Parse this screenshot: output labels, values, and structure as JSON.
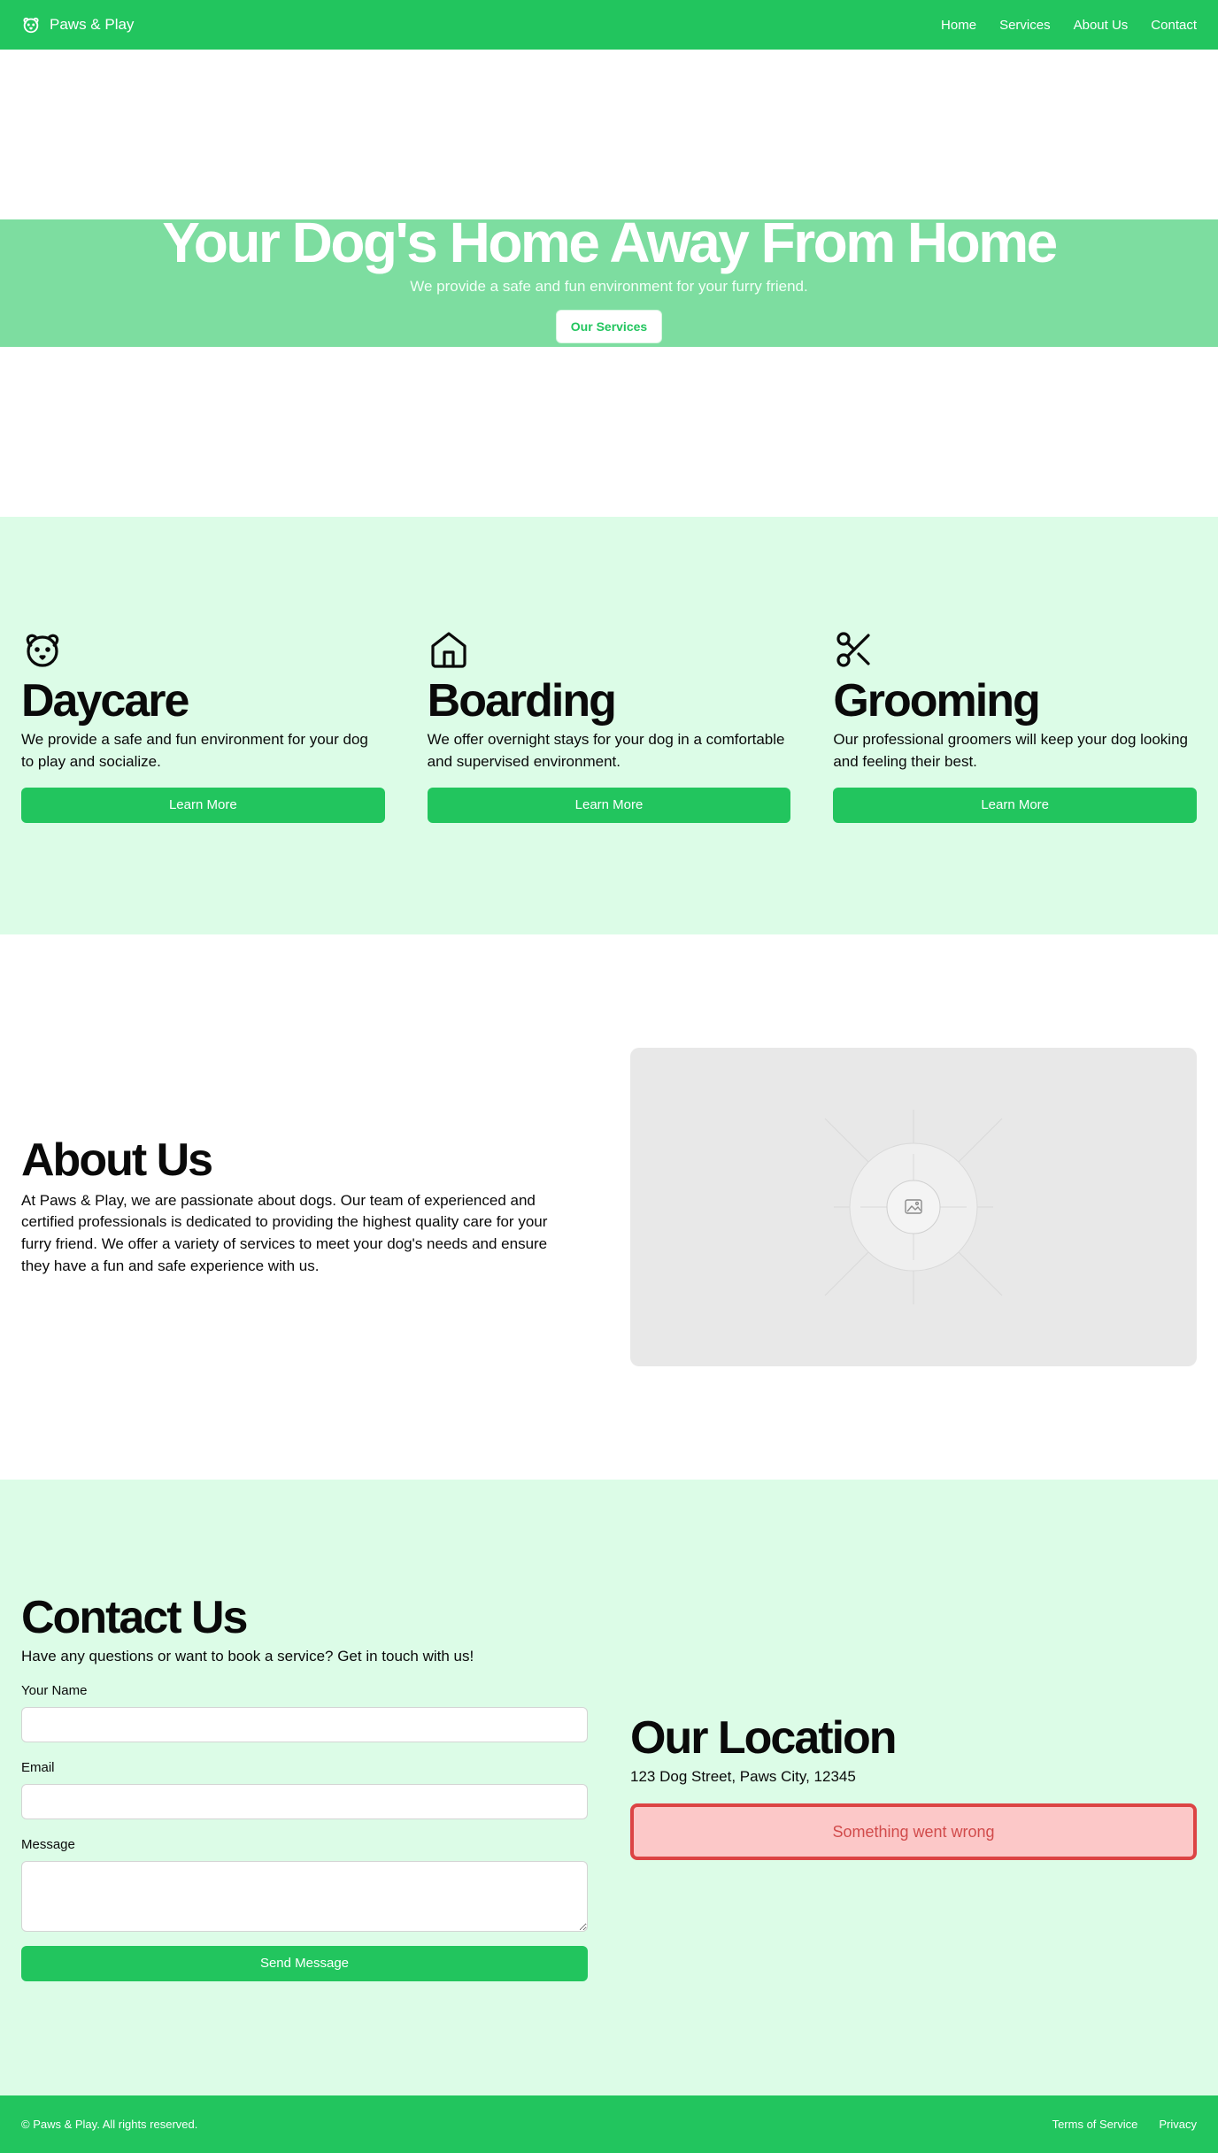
{
  "header": {
    "brand": "Paws & Play",
    "nav": [
      "Home",
      "Services",
      "About Us",
      "Contact"
    ]
  },
  "hero": {
    "title": "Your Dog's Home Away From Home",
    "subtitle": "We provide a safe and fun environment for your furry friend.",
    "cta": "Our Services"
  },
  "services": [
    {
      "icon": "dog-icon",
      "title": "Daycare",
      "description": "We provide a safe and fun environment for your dog to play and socialize.",
      "button": "Learn More"
    },
    {
      "icon": "house-icon",
      "title": "Boarding",
      "description": "We offer overnight stays for your dog in a comfortable and supervised environment.",
      "button": "Learn More"
    },
    {
      "icon": "scissors-icon",
      "title": "Grooming",
      "description": "Our professional groomers will keep your dog looking and feeling their best.",
      "button": "Learn More"
    }
  ],
  "about": {
    "title": "About Us",
    "description": "At Paws & Play, we are passionate about dogs. Our team of experienced and certified professionals is dedicated to providing the highest quality care for your furry friend. We offer a variety of services to meet your dog's needs and ensure they have a fun and safe experience with us.",
    "image_icon": "image-placeholder-icon"
  },
  "contact": {
    "title": "Contact Us",
    "intro": "Have any questions or want to book a service? Get in touch with us!",
    "name_label": "Your Name",
    "name_value": "",
    "email_label": "Email",
    "email_value": "",
    "message_label": "Message",
    "message_value": "",
    "submit": "Send Message"
  },
  "location": {
    "title": "Our Location",
    "address": "123 Dog Street, Paws City, 12345",
    "map_error": "Something went wrong"
  },
  "footer": {
    "copyright": "© Paws & Play. All rights reserved.",
    "links": [
      "Terms of Service",
      "Privacy"
    ]
  },
  "colors": {
    "primary": "#22c55e",
    "hero_band": "#7ddda0",
    "section_tint": "#dcfce7",
    "error_border": "#dc4444",
    "error_bg": "#fcc8c8"
  }
}
